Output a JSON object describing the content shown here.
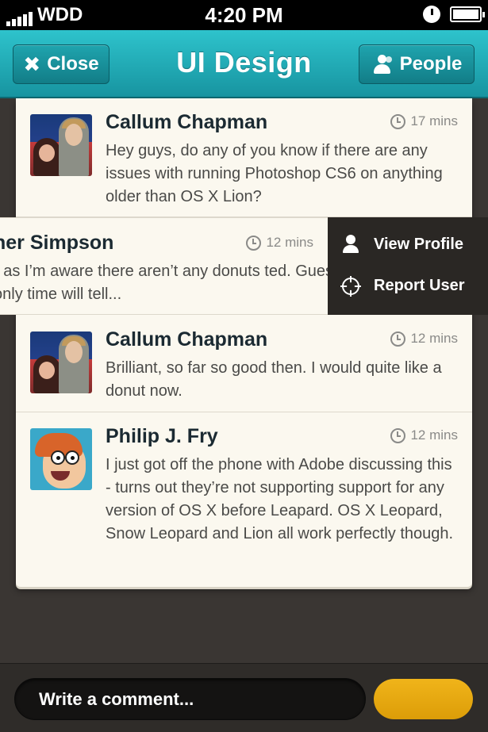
{
  "status_bar": {
    "carrier": "WDD",
    "time": "4:20 PM",
    "signal_bars": 5,
    "battery_level": 1.0
  },
  "nav": {
    "title": "UI Design",
    "close_label": "Close",
    "people_label": "People"
  },
  "messages": [
    {
      "name": "Callum Chapman",
      "time": "17 mins",
      "avatar": "avatar-photo-couple",
      "text": "Hey guys, do any of you know if there are any issues with running Photoshop CS6 on anything older than OS X Lion?"
    },
    {
      "name": "her Simpson",
      "time": "12 mins",
      "avatar": "none",
      "text": "r as I’m aware there aren’t any donuts ted. Guess only time will tell..."
    },
    {
      "name": "Callum Chapman",
      "time": "12 mins",
      "avatar": "avatar-photo-couple",
      "text": "Brilliant, so far so good then. I would quite like a donut now."
    },
    {
      "name": "Philip J. Fry",
      "time": "12 mins",
      "avatar": "avatar-cartoon-fry",
      "text": "I just got off the phone with Adobe discussing this - turns out they’re not supporting support for any version of OS X before Leapard. OS X Leopard, Snow Leopard and Lion all work perfectly though."
    }
  ],
  "swipe_actions": {
    "view_profile": "View Profile",
    "report_user": "Report User"
  },
  "composer": {
    "placeholder": "Write a comment..."
  },
  "colors": {
    "nav_teal": "#1fa4ae",
    "send_accent": "#e6a80f",
    "card_bg": "#fbf8ef",
    "background": "#3a3633"
  }
}
